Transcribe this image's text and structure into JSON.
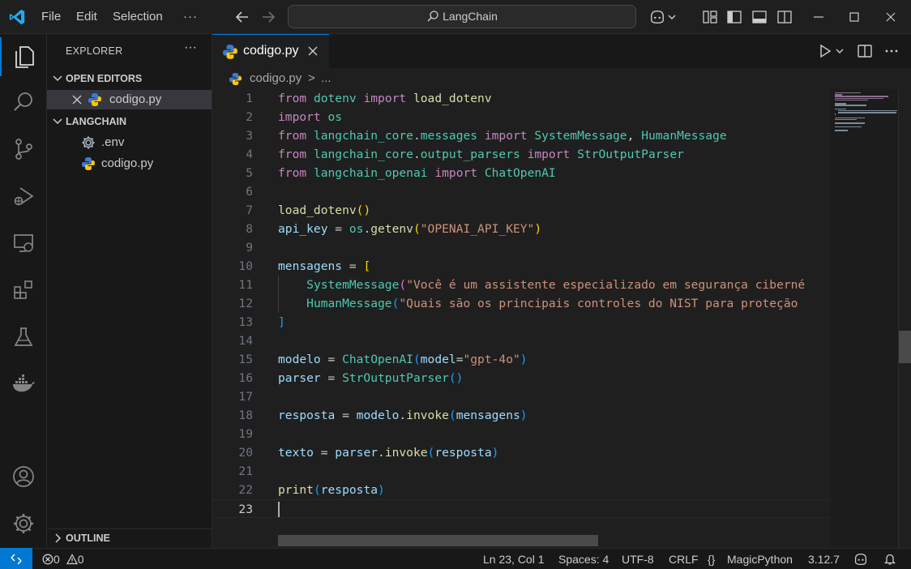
{
  "titlebar": {
    "menu": [
      "File",
      "Edit",
      "Selection"
    ],
    "more": "···",
    "command_center": "LangChain"
  },
  "sidebar": {
    "header": "EXPLORER",
    "more": "···",
    "open_editors_title": "OPEN EDITORS",
    "open_editors": [
      {
        "name": "codigo.py",
        "selected": true
      }
    ],
    "folder_title": "LANGCHAIN",
    "files": [
      {
        "name": ".env",
        "icon": "gear-icon"
      },
      {
        "name": "codigo.py",
        "icon": "python-icon"
      }
    ],
    "outline_title": "OUTLINE"
  },
  "editor": {
    "tab_label": "codigo.py",
    "breadcrumb": {
      "file": "codigo.py",
      "separator": ">",
      "symbol": "..."
    },
    "lines": [
      "from dotenv import load_dotenv",
      "import os",
      "from langchain_core.messages import SystemMessage, HumanMessage",
      "from langchain_core.output_parsers import StrOutputParser",
      "from langchain_openai import ChatOpenAI",
      "",
      "load_dotenv()",
      "api_key = os.getenv(\"OPENAI_API_KEY\")",
      "",
      "mensagens = [",
      "    SystemMessage(\"Você é um assistente especializado em segurança ciberné",
      "    HumanMessage(\"Quais são os principais controles do NIST para proteção ",
      "]",
      "",
      "modelo = ChatOpenAI(model=\"gpt-4o\")",
      "parser = StrOutputParser()",
      "",
      "resposta = modelo.invoke(mensagens)",
      "",
      "texto = parser.invoke(resposta)",
      "",
      "print(resposta)",
      ""
    ],
    "current_line": 23
  },
  "statusbar": {
    "errors": "0",
    "warnings": "0",
    "position": "Ln 23, Col 1",
    "spaces": "Spaces: 4",
    "encoding": "UTF-8",
    "eol": "CRLF",
    "language_braces": "{}",
    "language": "MagicPython",
    "python_version": "3.12.7"
  },
  "colors": {
    "accent": "#0078d4",
    "keyword": "#c586c0",
    "module": "#4ec9b0",
    "function": "#dcdcaa",
    "variable": "#9cdcfe",
    "string": "#ce9178"
  }
}
